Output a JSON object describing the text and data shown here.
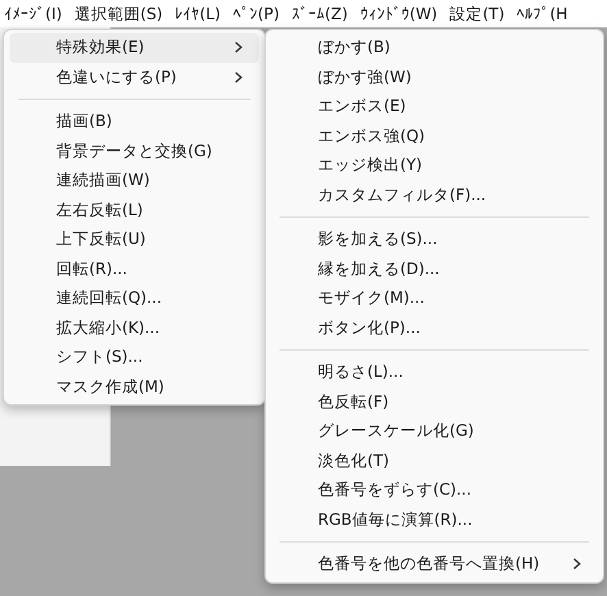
{
  "menubar": [
    "ｲﾒｰｼﾞ(I)",
    "選択範囲(S)",
    "ﾚｲﾔ(L)",
    "ﾍﾟﾝ(P)",
    "ｽﾞｰﾑ(Z)",
    "ｳｨﾝﾄﾞｳ(W)",
    "設定(T)",
    "ﾍﾙﾌﾟ(H"
  ],
  "menu": [
    {
      "kind": "item",
      "label": "特殊効果(E)",
      "submenu": true,
      "selected": true
    },
    {
      "kind": "item",
      "label": "色違いにする(P)",
      "submenu": true,
      "selected": false
    },
    {
      "kind": "separator"
    },
    {
      "kind": "item",
      "label": "描画(B)",
      "submenu": false,
      "selected": false
    },
    {
      "kind": "item",
      "label": "背景データと交換(G)",
      "submenu": false,
      "selected": false
    },
    {
      "kind": "item",
      "label": "連続描画(W)",
      "submenu": false,
      "selected": false
    },
    {
      "kind": "item",
      "label": "左右反転(L)",
      "submenu": false,
      "selected": false
    },
    {
      "kind": "item",
      "label": "上下反転(U)",
      "submenu": false,
      "selected": false
    },
    {
      "kind": "item",
      "label": "回転(R)...",
      "submenu": false,
      "selected": false
    },
    {
      "kind": "item",
      "label": "連続回転(Q)...",
      "submenu": false,
      "selected": false
    },
    {
      "kind": "item",
      "label": "拡大縮小(K)...",
      "submenu": false,
      "selected": false
    },
    {
      "kind": "item",
      "label": "シフト(S)...",
      "submenu": false,
      "selected": false
    },
    {
      "kind": "item",
      "label": "マスク作成(M)",
      "submenu": false,
      "selected": false
    }
  ],
  "submenu": [
    {
      "kind": "item",
      "label": "ぼかす(B)",
      "submenu": false,
      "selected": false
    },
    {
      "kind": "item",
      "label": "ぼかす強(W)",
      "submenu": false,
      "selected": false
    },
    {
      "kind": "item",
      "label": "エンボス(E)",
      "submenu": false,
      "selected": false
    },
    {
      "kind": "item",
      "label": "エンボス強(Q)",
      "submenu": false,
      "selected": false
    },
    {
      "kind": "item",
      "label": "エッジ検出(Y)",
      "submenu": false,
      "selected": false
    },
    {
      "kind": "item",
      "label": "カスタムフィルタ(F)...",
      "submenu": false,
      "selected": false
    },
    {
      "kind": "separator"
    },
    {
      "kind": "item",
      "label": "影を加える(S)...",
      "submenu": false,
      "selected": false
    },
    {
      "kind": "item",
      "label": "縁を加える(D)...",
      "submenu": false,
      "selected": false
    },
    {
      "kind": "item",
      "label": "モザイク(M)...",
      "submenu": false,
      "selected": false
    },
    {
      "kind": "item",
      "label": "ボタン化(P)...",
      "submenu": false,
      "selected": false
    },
    {
      "kind": "separator"
    },
    {
      "kind": "item",
      "label": "明るさ(L)...",
      "submenu": false,
      "selected": false
    },
    {
      "kind": "item",
      "label": "色反転(F)",
      "submenu": false,
      "selected": false
    },
    {
      "kind": "item",
      "label": "グレースケール化(G)",
      "submenu": false,
      "selected": false
    },
    {
      "kind": "item",
      "label": "淡色化(T)",
      "submenu": false,
      "selected": false
    },
    {
      "kind": "item",
      "label": "色番号をずらす(C)...",
      "submenu": false,
      "selected": false
    },
    {
      "kind": "item",
      "label": "RGB値毎に演算(R)...",
      "submenu": false,
      "selected": false
    },
    {
      "kind": "separator"
    },
    {
      "kind": "item",
      "label": "色番号を他の色番号へ置換(H)",
      "submenu": true,
      "selected": false
    }
  ]
}
